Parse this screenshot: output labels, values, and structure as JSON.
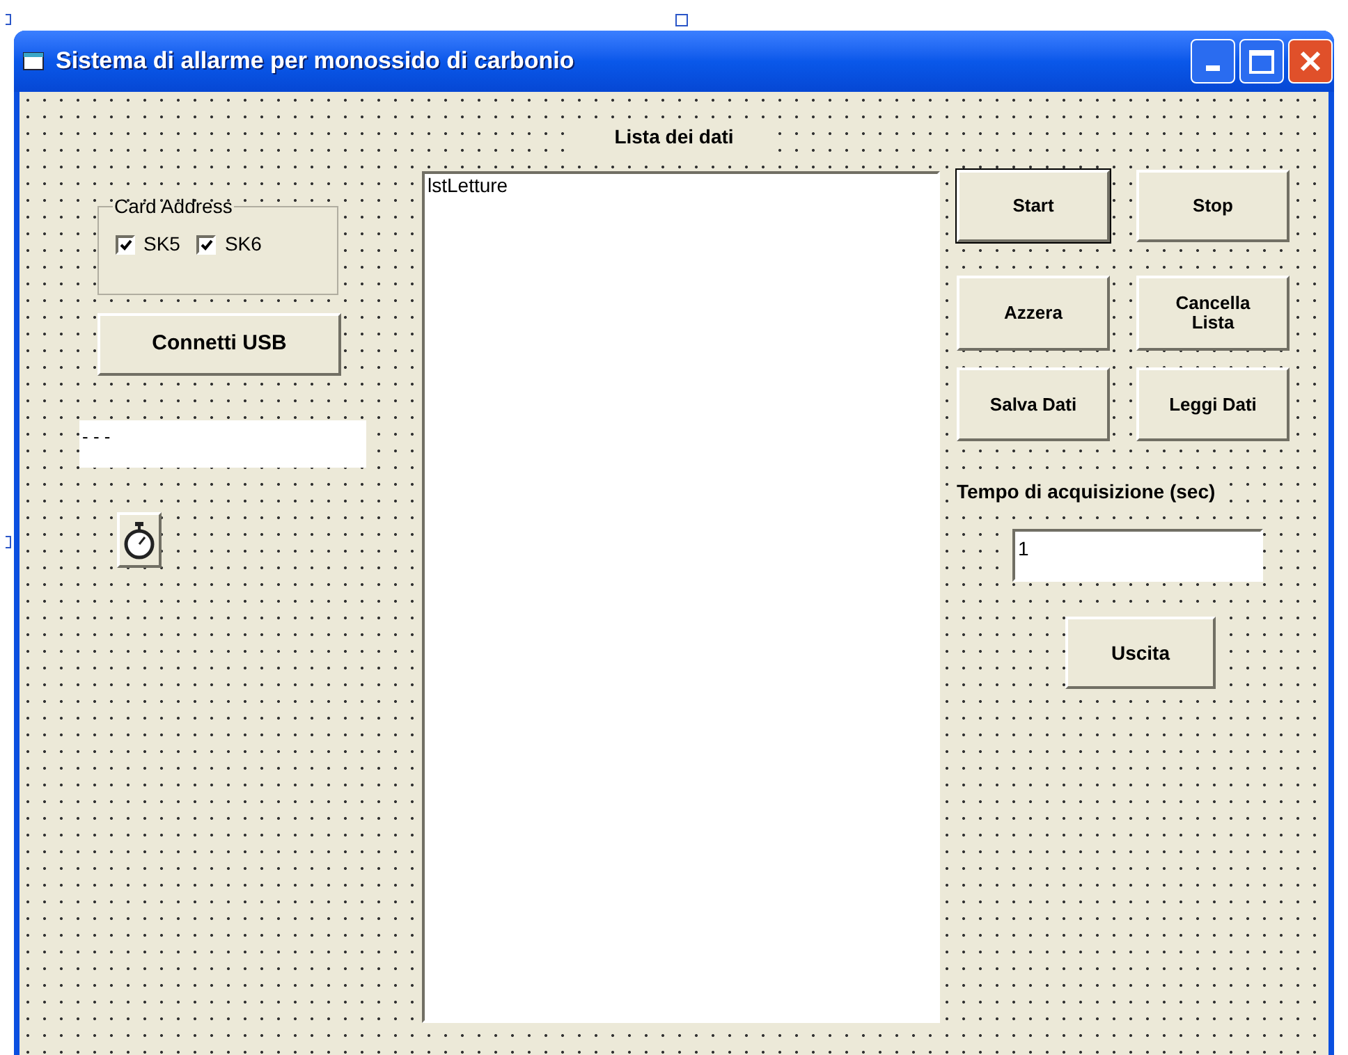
{
  "window": {
    "title": "Sistema di allarme per monossido di carbonio"
  },
  "list_heading": "Lista dei dati",
  "list": {
    "items": [
      "lstLetture"
    ]
  },
  "card_address": {
    "label": "Card Address",
    "checkboxes": [
      {
        "label": "SK5",
        "checked": true
      },
      {
        "label": "SK6",
        "checked": true
      }
    ]
  },
  "connect_button": "Connetti USB",
  "status_label": "- - -",
  "buttons": [
    {
      "label": "Start",
      "default": true
    },
    {
      "label": "Stop",
      "default": false
    },
    {
      "label": "Azzera",
      "default": false
    },
    {
      "label": "Cancella Lista",
      "default": false
    },
    {
      "label": "Salva Dati",
      "default": false
    },
    {
      "label": "Leggi Dati",
      "default": false
    }
  ],
  "interval": {
    "label": "Tempo di acquisizione (sec)",
    "value": "1"
  },
  "exit_button": "Uscita"
}
